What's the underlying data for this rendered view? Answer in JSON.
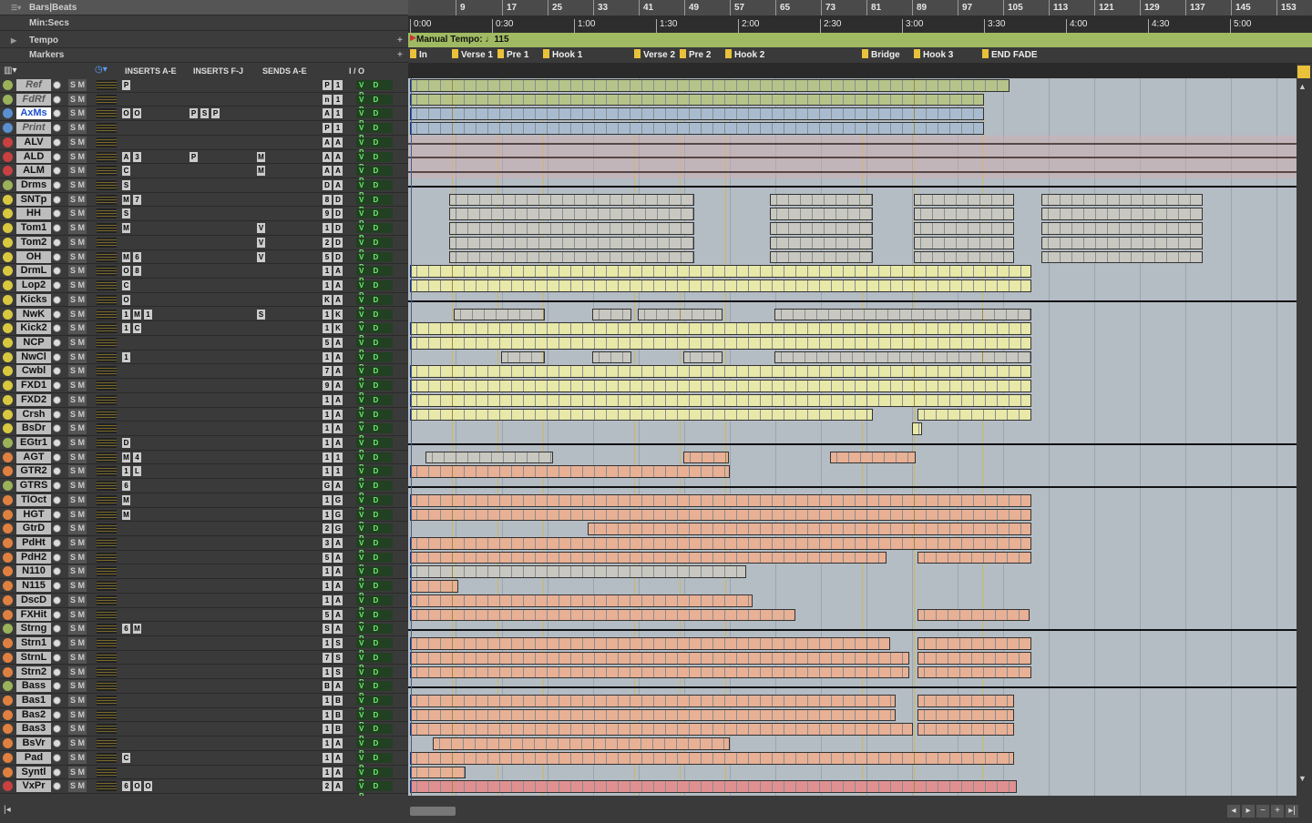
{
  "rulers": {
    "bars_beats": "Bars|Beats",
    "min_secs": "Min:Secs",
    "tempo": "Tempo",
    "markers": "Markers",
    "bar_ticks": [
      "9",
      "17",
      "25",
      "33",
      "41",
      "49",
      "57",
      "65",
      "73",
      "81",
      "89",
      "97",
      "105",
      "113",
      "121",
      "129",
      "137",
      "145",
      "153"
    ],
    "time_ticks": [
      "0:00",
      "0:30",
      "1:00",
      "1:30",
      "2:00",
      "2:30",
      "3:00",
      "3:30",
      "4:00",
      "4:30",
      "5:00"
    ],
    "tempo_label": "Manual Tempo:",
    "tempo_value": "♩115"
  },
  "markers": [
    {
      "label": "In"
    },
    {
      "label": "Verse 1"
    },
    {
      "label": "Pre 1"
    },
    {
      "label": "Hook 1"
    },
    {
      "label": "Verse 2"
    },
    {
      "label": "Pre 2"
    },
    {
      "label": "Hook 2"
    },
    {
      "label": "Bridge"
    },
    {
      "label": "Hook 3"
    },
    {
      "label": "END FADE"
    }
  ],
  "columns": {
    "inserts_ae": "INSERTS A-E",
    "inserts_fj": "INSERTS F-J",
    "sends_ae": "SENDS A-E",
    "io": "I / O"
  },
  "solo_mute": "S M",
  "vdp": "V D P",
  "colors": {
    "audio_yellow": "#e8e8a8",
    "audio_orange": "#e8b094",
    "aux_green": "#b6c48a",
    "aux_blue": "#a9bccf",
    "tempo_bar": "#9fba62",
    "marker_flag": "#e9c13a"
  },
  "tracks": [
    {
      "name": "Ref",
      "rec": "#9ab35a",
      "ital": true,
      "ins": [
        "P"
      ],
      "io": [
        "P",
        "1"
      ]
    },
    {
      "name": "FdRf",
      "rec": "#9ab35a",
      "ital": true,
      "ins": [],
      "io": [
        "n",
        "1"
      ]
    },
    {
      "name": "AxMs",
      "rec": "#5a8fd0",
      "sel": true,
      "ins": [
        "O",
        "O"
      ],
      "insfj": [
        "P",
        "S",
        "P"
      ],
      "io": [
        "A",
        "1"
      ]
    },
    {
      "name": "Print",
      "rec": "#5a8fd0",
      "ital": true,
      "ins": [],
      "io": [
        "P",
        "1"
      ]
    },
    {
      "name": "ALV",
      "rec": "#c84040",
      "ins": [],
      "io": [
        "A",
        "A"
      ]
    },
    {
      "name": "ALD",
      "rec": "#c84040",
      "ins": [
        "A",
        "3"
      ],
      "insfj": [
        "P"
      ],
      "send": "M",
      "io": [
        "A",
        "A"
      ]
    },
    {
      "name": "ALM",
      "rec": "#c84040",
      "ins": [
        "C"
      ],
      "send": "M",
      "io": [
        "A",
        "A"
      ]
    },
    {
      "name": "Drms",
      "rec": "#9ab35a",
      "ins": [
        "S"
      ],
      "io": [
        "D",
        "A"
      ]
    },
    {
      "name": "SNTp",
      "rec": "#d8c840",
      "ins": [
        "M",
        "7"
      ],
      "io": [
        "8",
        "D"
      ]
    },
    {
      "name": "HH",
      "rec": "#d8c840",
      "ins": [
        "S"
      ],
      "io": [
        "9",
        "D"
      ]
    },
    {
      "name": "Tom1",
      "rec": "#d8c840",
      "ins": [
        "M"
      ],
      "send": "V",
      "io": [
        "1",
        "D"
      ]
    },
    {
      "name": "Tom2",
      "rec": "#d8c840",
      "ins": [],
      "send": "V",
      "io": [
        "2",
        "D"
      ]
    },
    {
      "name": "OH",
      "rec": "#d8c840",
      "ins": [
        "M",
        "6"
      ],
      "send": "V",
      "io": [
        "5",
        "D"
      ]
    },
    {
      "name": "DrmL",
      "rec": "#d8c840",
      "ins": [
        "O",
        "8"
      ],
      "io": [
        "1",
        "A"
      ]
    },
    {
      "name": "Lop2",
      "rec": "#d8c840",
      "ins": [
        "C"
      ],
      "io": [
        "1",
        "A"
      ]
    },
    {
      "name": "Kicks",
      "rec": "#d8c840",
      "ins": [
        "O"
      ],
      "io": [
        "K",
        "A"
      ]
    },
    {
      "name": "NwK",
      "rec": "#d8c840",
      "ins": [
        "1",
        "M",
        "1"
      ],
      "send": "S",
      "io": [
        "1",
        "K"
      ]
    },
    {
      "name": "Kick2",
      "rec": "#d8c840",
      "ins": [
        "1",
        "C"
      ],
      "io": [
        "1",
        "K"
      ]
    },
    {
      "name": "NCP",
      "rec": "#d8c840",
      "ins": [],
      "io": [
        "5",
        "A"
      ]
    },
    {
      "name": "NwCl",
      "rec": "#d8c840",
      "ins": [
        "1"
      ],
      "io": [
        "1",
        "A"
      ]
    },
    {
      "name": "Cwbl",
      "rec": "#d8c840",
      "ins": [],
      "io": [
        "7",
        "A"
      ]
    },
    {
      "name": "FXD1",
      "rec": "#d8c840",
      "ins": [],
      "io": [
        "9",
        "A"
      ]
    },
    {
      "name": "FXD2",
      "rec": "#d8c840",
      "ins": [],
      "io": [
        "1",
        "A"
      ]
    },
    {
      "name": "Crsh",
      "rec": "#d8c840",
      "ins": [],
      "io": [
        "1",
        "A"
      ]
    },
    {
      "name": "BsDr",
      "rec": "#d8c840",
      "ins": [],
      "io": [
        "1",
        "A"
      ]
    },
    {
      "name": "EGtr1",
      "rec": "#9ab35a",
      "ins": [
        "D"
      ],
      "io": [
        "1",
        "A"
      ]
    },
    {
      "name": "AGT",
      "rec": "#e08040",
      "ins": [
        "M",
        "4"
      ],
      "io": [
        "1",
        "1"
      ]
    },
    {
      "name": "GTR2",
      "rec": "#e08040",
      "ins": [
        "1",
        "L"
      ],
      "io": [
        "1",
        "1"
      ]
    },
    {
      "name": "GTRS",
      "rec": "#9ab35a",
      "ins": [
        "6"
      ],
      "io": [
        "G",
        "A"
      ]
    },
    {
      "name": "TlOct",
      "rec": "#e08040",
      "ins": [
        "M"
      ],
      "io": [
        "1",
        "G"
      ]
    },
    {
      "name": "HGT",
      "rec": "#e08040",
      "ins": [
        "M"
      ],
      "io": [
        "1",
        "G"
      ]
    },
    {
      "name": "GtrD",
      "rec": "#e08040",
      "ins": [],
      "io": [
        "2",
        "G"
      ]
    },
    {
      "name": "PdHt",
      "rec": "#e08040",
      "ins": [],
      "io": [
        "3",
        "A"
      ]
    },
    {
      "name": "PdH2",
      "rec": "#e08040",
      "ins": [],
      "io": [
        "5",
        "A"
      ]
    },
    {
      "name": "N110",
      "rec": "#e08040",
      "ins": [],
      "io": [
        "1",
        "A"
      ]
    },
    {
      "name": "N115",
      "rec": "#e08040",
      "ins": [],
      "io": [
        "1",
        "A"
      ]
    },
    {
      "name": "DscD",
      "rec": "#e08040",
      "ins": [],
      "io": [
        "1",
        "A"
      ]
    },
    {
      "name": "FXHit",
      "rec": "#e08040",
      "ins": [],
      "io": [
        "5",
        "A"
      ]
    },
    {
      "name": "Strng",
      "rec": "#9ab35a",
      "ins": [
        "6",
        "M"
      ],
      "io": [
        "S",
        "A"
      ]
    },
    {
      "name": "Strn1",
      "rec": "#e08040",
      "ins": [],
      "io": [
        "1",
        "S"
      ]
    },
    {
      "name": "StrnL",
      "rec": "#e08040",
      "ins": [],
      "io": [
        "7",
        "S"
      ]
    },
    {
      "name": "Strn2",
      "rec": "#e08040",
      "ins": [],
      "io": [
        "1",
        "S"
      ]
    },
    {
      "name": "Bass",
      "rec": "#9ab35a",
      "ins": [],
      "io": [
        "B",
        "A"
      ]
    },
    {
      "name": "Bas1",
      "rec": "#e08040",
      "ins": [],
      "io": [
        "1",
        "B"
      ]
    },
    {
      "name": "Bas2",
      "rec": "#e08040",
      "ins": [],
      "io": [
        "1",
        "B"
      ]
    },
    {
      "name": "Bas3",
      "rec": "#e08040",
      "ins": [],
      "io": [
        "1",
        "B"
      ]
    },
    {
      "name": "BsVr",
      "rec": "#e08040",
      "ins": [],
      "io": [
        "1",
        "A"
      ]
    },
    {
      "name": "Pad",
      "rec": "#e08040",
      "ins": [
        "C"
      ],
      "io": [
        "1",
        "A"
      ]
    },
    {
      "name": "Syntl",
      "rec": "#e08040",
      "ins": [],
      "io": [
        "1",
        "A"
      ]
    },
    {
      "name": "VxPr",
      "rec": "#c84040",
      "ins": [
        "6",
        "O",
        "O"
      ],
      "io": [
        "2",
        "A"
      ]
    }
  ]
}
